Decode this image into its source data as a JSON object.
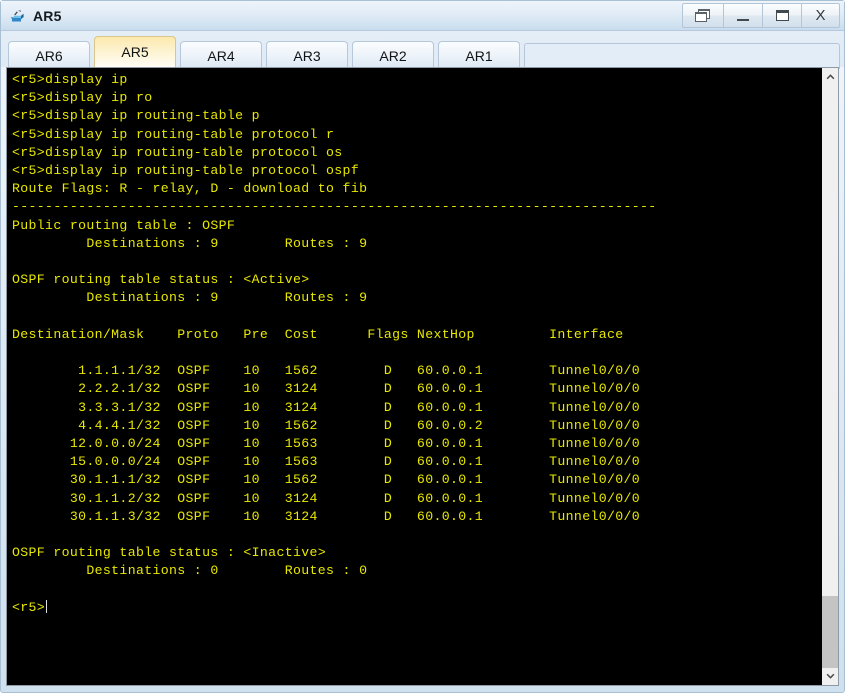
{
  "window": {
    "title": "AR5",
    "icon": "router-icon",
    "controls": {
      "restore_all_label": "restore-windows",
      "minimize_label": "_",
      "maximize_label": "maximize",
      "close_label": "X"
    }
  },
  "tabs": [
    {
      "label": "AR6",
      "active": false
    },
    {
      "label": "AR5",
      "active": true
    },
    {
      "label": "AR4",
      "active": false
    },
    {
      "label": "AR3",
      "active": false
    },
    {
      "label": "AR2",
      "active": false
    },
    {
      "label": "AR1",
      "active": false
    }
  ],
  "terminal": {
    "foreground_color": "#e8e800",
    "background_color": "#000000",
    "lines": [
      "<r5>display ip",
      "<r5>display ip ro",
      "<r5>display ip routing-table p",
      "<r5>display ip routing-table protocol r",
      "<r5>display ip routing-table protocol os",
      "<r5>display ip routing-table protocol ospf",
      "Route Flags: R - relay, D - download to fib",
      "------------------------------------------------------------------------------",
      "Public routing table : OSPF",
      "         Destinations : 9        Routes : 9",
      "",
      "OSPF routing table status : <Active>",
      "         Destinations : 9        Routes : 9",
      "",
      "Destination/Mask    Proto   Pre  Cost      Flags NextHop         Interface",
      "",
      "        1.1.1.1/32  OSPF    10   1562        D   60.0.0.1        Tunnel0/0/0",
      "        2.2.2.1/32  OSPF    10   3124        D   60.0.0.1        Tunnel0/0/0",
      "        3.3.3.1/32  OSPF    10   3124        D   60.0.0.1        Tunnel0/0/0",
      "        4.4.4.1/32  OSPF    10   1562        D   60.0.0.2        Tunnel0/0/0",
      "       12.0.0.0/24  OSPF    10   1563        D   60.0.0.1        Tunnel0/0/0",
      "       15.0.0.0/24  OSPF    10   1563        D   60.0.0.1        Tunnel0/0/0",
      "       30.1.1.1/32  OSPF    10   1562        D   60.0.0.1        Tunnel0/0/0",
      "       30.1.1.2/32  OSPF    10   3124        D   60.0.0.1        Tunnel0/0/0",
      "       30.1.1.3/32  OSPF    10   3124        D   60.0.0.1        Tunnel0/0/0",
      "",
      "OSPF routing table status : <Inactive>",
      "         Destinations : 0        Routes : 0",
      "",
      "<r5>"
    ],
    "prompt": "<r5>",
    "commands_entered": [
      "display ip",
      "display ip ro",
      "display ip routing-table p",
      "display ip routing-table protocol r",
      "display ip routing-table protocol os",
      "display ip routing-table protocol ospf"
    ],
    "route_flags_legend": "Route Flags: R - relay, D - download to fib",
    "public_routing_table": "Public routing table : OSPF",
    "public_destinations": "9",
    "public_routes": "9",
    "active_status_label": "OSPF routing table status : <Active>",
    "active_destinations": "9",
    "active_routes": "9",
    "inactive_status_label": "OSPF routing table status : <Inactive>",
    "inactive_destinations": "0",
    "inactive_routes": "0",
    "table_headers": [
      "Destination/Mask",
      "Proto",
      "Pre",
      "Cost",
      "Flags",
      "NextHop",
      "Interface"
    ],
    "table_rows": [
      [
        "1.1.1.1/32",
        "OSPF",
        "10",
        "1562",
        "D",
        "60.0.0.1",
        "Tunnel0/0/0"
      ],
      [
        "2.2.2.1/32",
        "OSPF",
        "10",
        "3124",
        "D",
        "60.0.0.1",
        "Tunnel0/0/0"
      ],
      [
        "3.3.3.1/32",
        "OSPF",
        "10",
        "3124",
        "D",
        "60.0.0.1",
        "Tunnel0/0/0"
      ],
      [
        "4.4.4.1/32",
        "OSPF",
        "10",
        "1562",
        "D",
        "60.0.0.2",
        "Tunnel0/0/0"
      ],
      [
        "12.0.0.0/24",
        "OSPF",
        "10",
        "1563",
        "D",
        "60.0.0.1",
        "Tunnel0/0/0"
      ],
      [
        "15.0.0.0/24",
        "OSPF",
        "10",
        "1563",
        "D",
        "60.0.0.1",
        "Tunnel0/0/0"
      ],
      [
        "30.1.1.1/32",
        "OSPF",
        "10",
        "1562",
        "D",
        "60.0.0.1",
        "Tunnel0/0/0"
      ],
      [
        "30.1.1.2/32",
        "OSPF",
        "10",
        "3124",
        "D",
        "60.0.0.1",
        "Tunnel0/0/0"
      ],
      [
        "30.1.1.3/32",
        "OSPF",
        "10",
        "3124",
        "D",
        "60.0.0.1",
        "Tunnel0/0/0"
      ]
    ]
  },
  "scrollbar": {
    "up_arrow": "chevron-up-icon",
    "down_arrow": "chevron-down-icon"
  }
}
